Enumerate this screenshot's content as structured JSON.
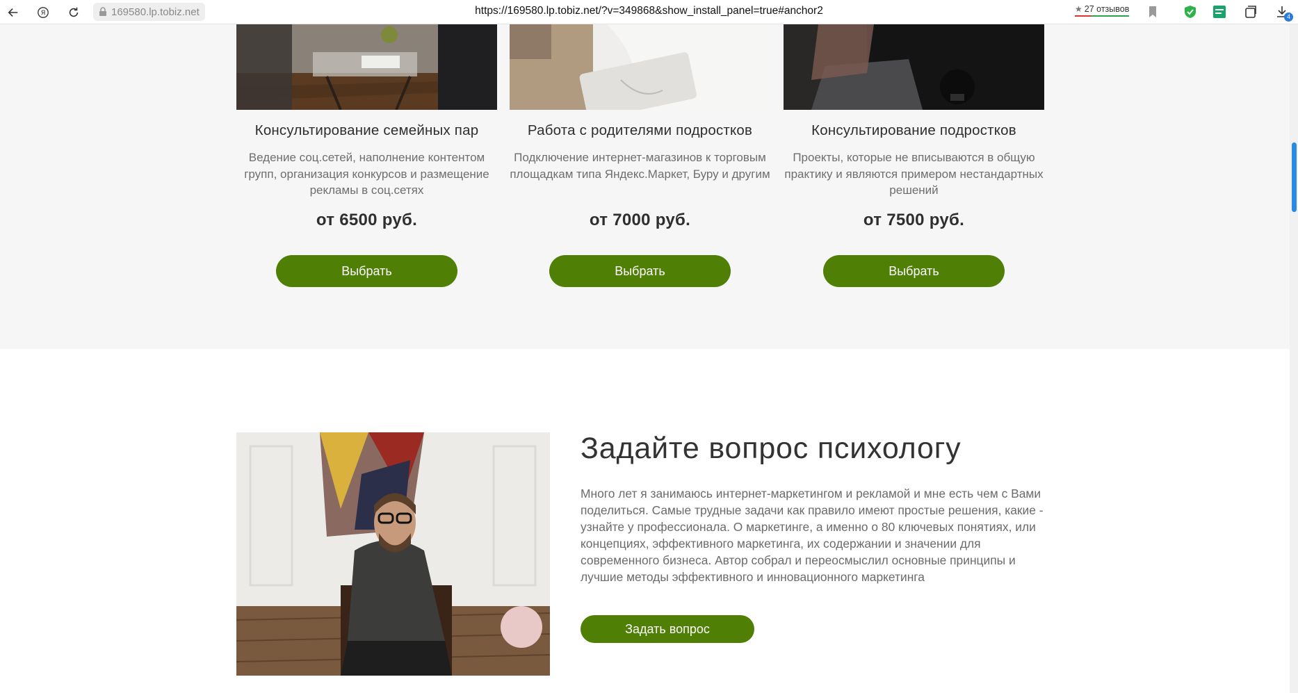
{
  "browser": {
    "domain": "169580.lp.tobiz.net",
    "url": "https://169580.lp.tobiz.net/?v=349868&show_install_panel=true#anchor2",
    "reviews": "27 отзывов",
    "download_badge": "4"
  },
  "services": [
    {
      "title": "Консультирование семейных пар",
      "description": "Ведение соц.сетей, наполнение контентом групп, организация конкурсов и размещение рекламы в соц.сетях",
      "price": "от 6500 руб.",
      "button": "Выбрать"
    },
    {
      "title": "Работа с родителями подростков",
      "description": "Подключение интернет-магазинов к торговым площадкам типа Яндекс.Маркет, Буру и другим",
      "price": "от 7000 руб.",
      "button": "Выбрать"
    },
    {
      "title": "Консультирование подростков",
      "description": "Проекты, которые не вписываются в общую практику и являются примером нестандартных решений",
      "price": "от 7500 руб.",
      "button": "Выбрать"
    }
  ],
  "ask": {
    "title": "Задайте вопрос психологу",
    "text": "Много лет я занимаюсь интернет-маркетингом и рекламой и мне есть чем с Вами поделиться. Самые трудные задачи как правило имеют простые решения, какие - узнайте у профессионала. О маркетинге, а именно о 80 ключевых понятиях, или концепциях, эффективного маркетинга, их содержании и значении для современного бизнеса. Автор собрал и переосмыслил основные принципы и лучшие методы эффективного и инновационного маркетинга",
    "button": "Задать вопрос"
  },
  "colors": {
    "accent_green": "#4f7f05",
    "section_bg": "#f6f6f6",
    "scroll_thumb": "#2a8ae2"
  }
}
